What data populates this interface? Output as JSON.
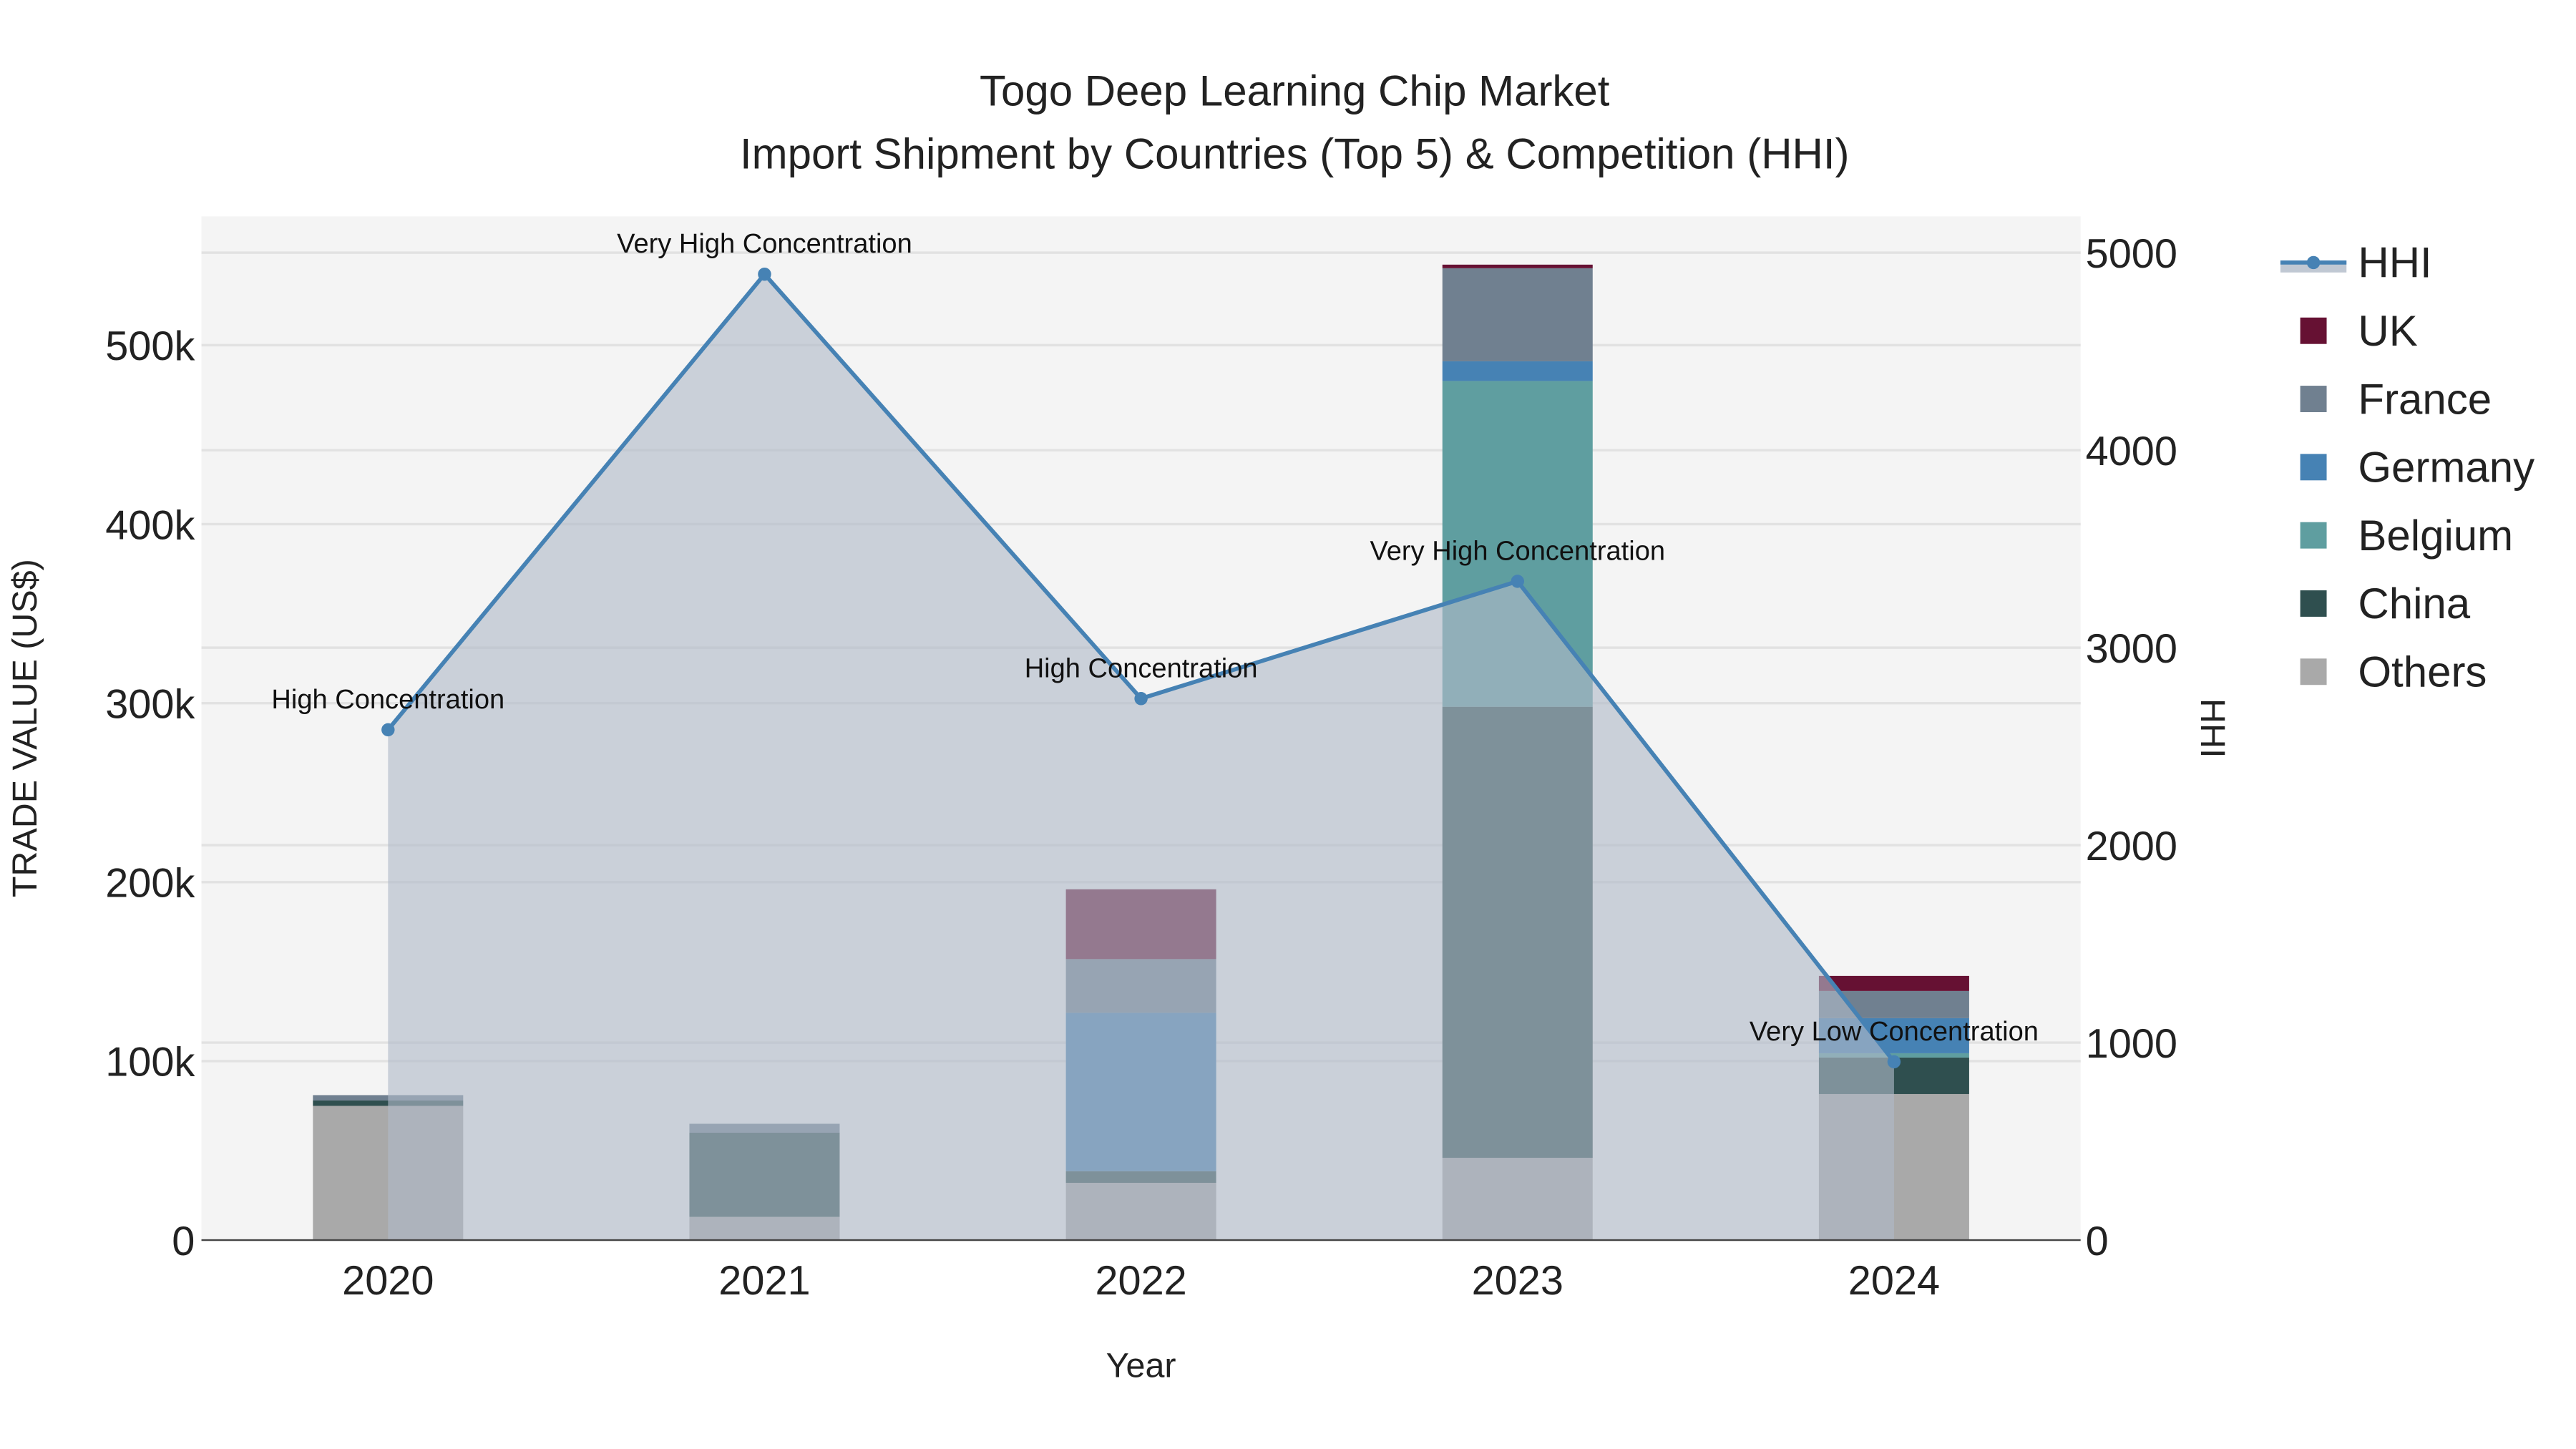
{
  "chart_data": {
    "type": "bar",
    "title": "Togo Deep Learning Chip Market",
    "subtitle": "Import Shipment by Countries (Top 5) & Competition (HHI)",
    "xlabel": "Year",
    "ylabel": "TRADE VALUE (US$)",
    "y2label": "HHI",
    "categories": [
      "2020",
      "2021",
      "2022",
      "2023",
      "2024"
    ],
    "ylim": [
      0,
      572000
    ],
    "y2lim": [
      0,
      5184
    ],
    "yticks": [
      0,
      100000,
      200000,
      300000,
      400000,
      500000
    ],
    "ytick_labels": [
      "0",
      "100k",
      "200k",
      "300k",
      "400k",
      "500k"
    ],
    "y2ticks": [
      0,
      1000,
      2000,
      3000,
      4000,
      5000
    ],
    "y2tick_labels": [
      "0",
      "1000",
      "2000",
      "3000",
      "4000",
      "5000"
    ],
    "grid": true,
    "legend_position": "right",
    "series": [
      {
        "name": "Others",
        "color": "#A9A9A9",
        "values": [
          75000,
          13000,
          32000,
          46000,
          81600
        ]
      },
      {
        "name": "China",
        "color": "#2F4F4F",
        "values": [
          3000,
          47000,
          6500,
          252000,
          20400
        ]
      },
      {
        "name": "Belgium",
        "color": "#5F9EA0",
        "values": [
          0,
          0,
          0,
          182000,
          2400
        ]
      },
      {
        "name": "Germany",
        "color": "#4682B4",
        "values": [
          0,
          0,
          88500,
          11000,
          19600
        ]
      },
      {
        "name": "France",
        "color": "#708090",
        "values": [
          3000,
          5000,
          30000,
          52000,
          15200
        ]
      },
      {
        "name": "UK",
        "color": "#661133",
        "values": [
          0,
          0,
          39000,
          2000,
          8400
        ]
      }
    ],
    "hhi": {
      "name": "HHI",
      "color": "#4682B4",
      "values": [
        2584,
        4891,
        2742,
        3336,
        903
      ],
      "annotations": [
        "High Concentration",
        "Very High Concentration",
        "High Concentration",
        "Very High Concentration",
        "Very Low Concentration"
      ]
    },
    "legend_order": [
      "HHI",
      "UK",
      "France",
      "Germany",
      "Belgium",
      "China",
      "Others"
    ]
  }
}
